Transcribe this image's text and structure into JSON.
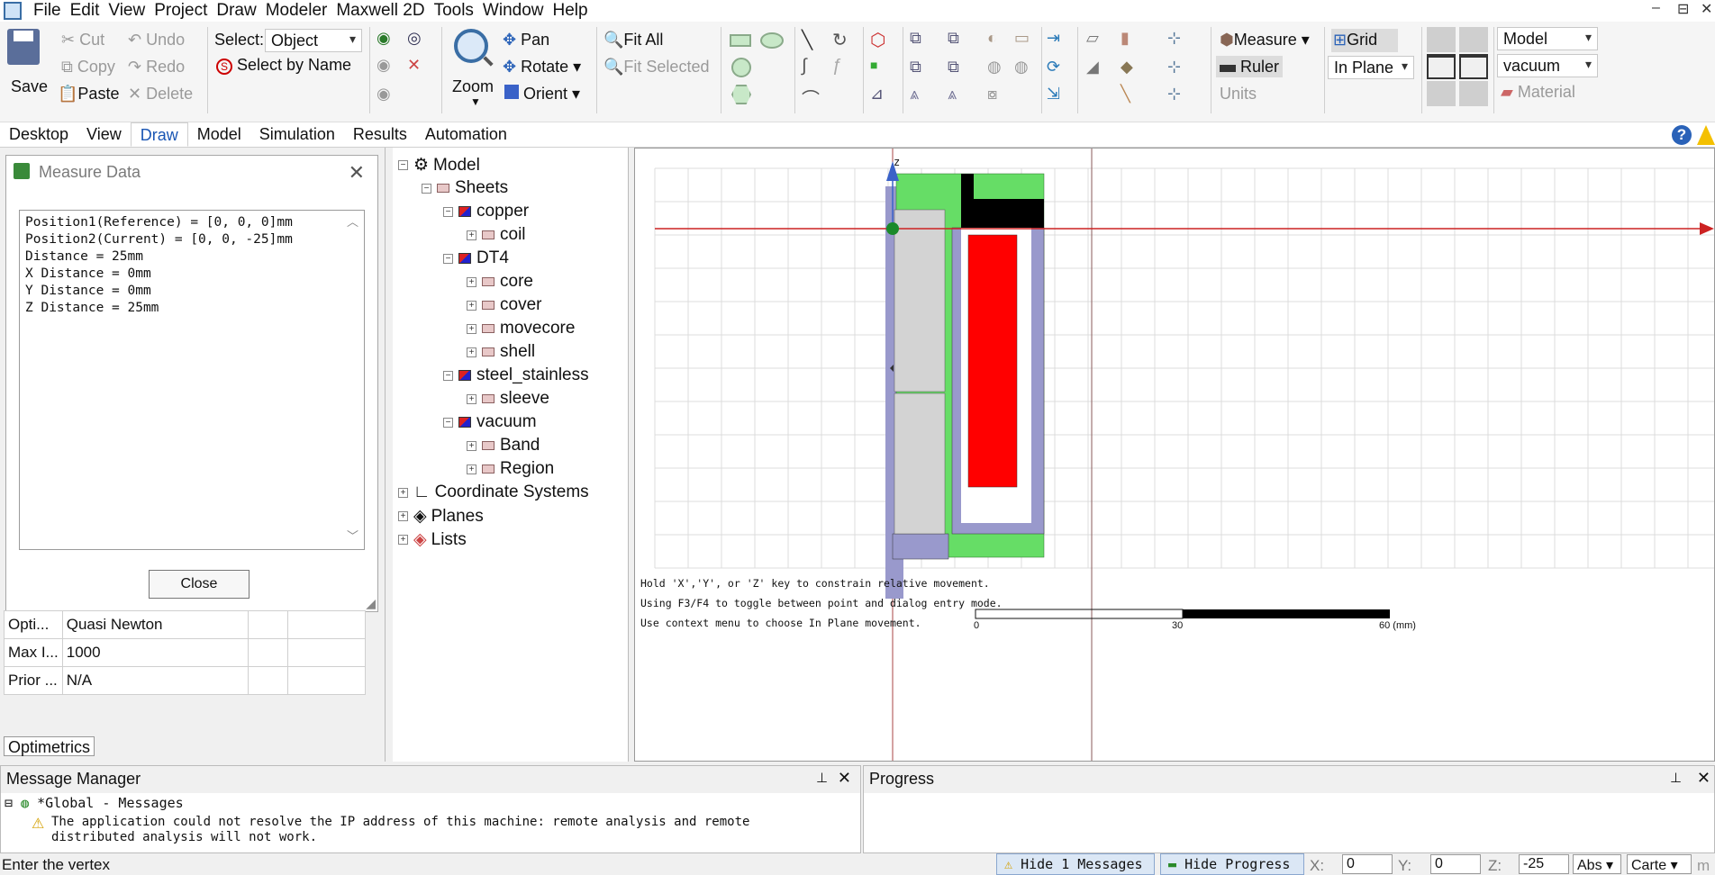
{
  "menu": [
    "File",
    "Edit",
    "View",
    "Project",
    "Draw",
    "Modeler",
    "Maxwell 2D",
    "Tools",
    "Window",
    "Help"
  ],
  "window_controls": [
    "–",
    "⊟",
    "✕"
  ],
  "ribbon": {
    "save": "Save",
    "cut": "Cut",
    "copy": "Copy",
    "paste": "Paste",
    "undo": "Undo",
    "redo": "Redo",
    "delete": "Delete",
    "select_label": "Select:",
    "select_value": "Object",
    "select_by_name": "Select by Name",
    "zoom": "Zoom",
    "pan": "Pan",
    "rotate": "Rotate",
    "orient": "Orient",
    "fit_all": "Fit All",
    "fit_selected": "Fit Selected",
    "measure": "Measure",
    "ruler": "Ruler",
    "units": "Units",
    "grid": "Grid",
    "grid_plane": "In Plane",
    "model_combo": "Model",
    "material_combo": "vacuum",
    "material": "Material"
  },
  "tabs": [
    "Desktop",
    "View",
    "Draw",
    "Model",
    "Simulation",
    "Results",
    "Automation"
  ],
  "active_tab": "Draw",
  "measure_dialog": {
    "title": "Measure Data",
    "lines": [
      "Position1(Reference) = [0, 0, 0]mm",
      "Position2(Current) = [0, 0, -25]mm",
      "Distance = 25mm",
      "X Distance = 0mm",
      "Y Distance = 0mm",
      "Z Distance = 25mm"
    ],
    "close": "Close"
  },
  "properties": [
    {
      "name": "Opti...",
      "value": "Quasi Newton"
    },
    {
      "name": "Max I...",
      "value": "1000"
    },
    {
      "name": "Prior ...",
      "value": "N/A"
    }
  ],
  "optimetrics_tab": "Optimetrics",
  "tree": {
    "root": "Model",
    "sheets": "Sheets",
    "copper": "copper",
    "coil": "coil",
    "dt4": "DT4",
    "core": "core",
    "cover": "cover",
    "movecore": "movecore",
    "shell": "shell",
    "steel": "steel_stainless",
    "sleeve": "sleeve",
    "vacuum": "vacuum",
    "band": "Band",
    "region": "Region",
    "coords": "Coordinate Systems",
    "planes": "Planes",
    "lists": "Lists"
  },
  "viewport": {
    "axis_label": "z",
    "hints": [
      "Hold 'X','Y', or 'Z' key to constrain relative movement.",
      "Using F3/F4 to toggle between point and dialog entry mode.",
      "Use context menu to choose In Plane movement."
    ],
    "scale": {
      "ticks": [
        "0",
        "30",
        "60 (mm)"
      ]
    },
    "colors": {
      "green": "#66dd66",
      "black": "#000000",
      "gray": "#d3d3d3",
      "lavender": "#9999cc",
      "red": "#ff0000"
    }
  },
  "message_manager": {
    "title": "Message Manager",
    "global": "*Global - Messages",
    "warning": "The application could not resolve the IP address of this machine: remote analysis and remote distributed analysis will not work."
  },
  "progress": {
    "title": "Progress"
  },
  "status": {
    "text": "Enter the vertex",
    "hide_messages": "Hide 1 Messages",
    "hide_progress": "Hide Progress",
    "x_label": "X:",
    "x": "0",
    "y_label": "Y:",
    "y": "0",
    "z_label": "Z:",
    "z": "-25",
    "abs": "Abs",
    "coord": "Carte"
  }
}
